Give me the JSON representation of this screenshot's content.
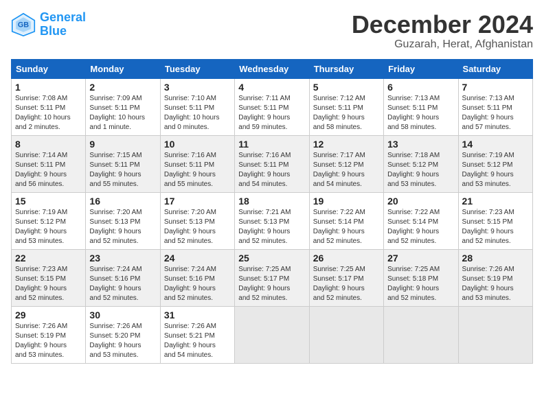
{
  "header": {
    "logo_line1": "General",
    "logo_line2": "Blue",
    "month": "December 2024",
    "location": "Guzarah, Herat, Afghanistan"
  },
  "days_of_week": [
    "Sunday",
    "Monday",
    "Tuesday",
    "Wednesday",
    "Thursday",
    "Friday",
    "Saturday"
  ],
  "weeks": [
    [
      {
        "day": "1",
        "info": "Sunrise: 7:08 AM\nSunset: 5:11 PM\nDaylight: 10 hours\nand 2 minutes."
      },
      {
        "day": "2",
        "info": "Sunrise: 7:09 AM\nSunset: 5:11 PM\nDaylight: 10 hours\nand 1 minute."
      },
      {
        "day": "3",
        "info": "Sunrise: 7:10 AM\nSunset: 5:11 PM\nDaylight: 10 hours\nand 0 minutes."
      },
      {
        "day": "4",
        "info": "Sunrise: 7:11 AM\nSunset: 5:11 PM\nDaylight: 9 hours\nand 59 minutes."
      },
      {
        "day": "5",
        "info": "Sunrise: 7:12 AM\nSunset: 5:11 PM\nDaylight: 9 hours\nand 58 minutes."
      },
      {
        "day": "6",
        "info": "Sunrise: 7:13 AM\nSunset: 5:11 PM\nDaylight: 9 hours\nand 58 minutes."
      },
      {
        "day": "7",
        "info": "Sunrise: 7:13 AM\nSunset: 5:11 PM\nDaylight: 9 hours\nand 57 minutes."
      }
    ],
    [
      {
        "day": "8",
        "info": "Sunrise: 7:14 AM\nSunset: 5:11 PM\nDaylight: 9 hours\nand 56 minutes."
      },
      {
        "day": "9",
        "info": "Sunrise: 7:15 AM\nSunset: 5:11 PM\nDaylight: 9 hours\nand 55 minutes."
      },
      {
        "day": "10",
        "info": "Sunrise: 7:16 AM\nSunset: 5:11 PM\nDaylight: 9 hours\nand 55 minutes."
      },
      {
        "day": "11",
        "info": "Sunrise: 7:16 AM\nSunset: 5:11 PM\nDaylight: 9 hours\nand 54 minutes."
      },
      {
        "day": "12",
        "info": "Sunrise: 7:17 AM\nSunset: 5:12 PM\nDaylight: 9 hours\nand 54 minutes."
      },
      {
        "day": "13",
        "info": "Sunrise: 7:18 AM\nSunset: 5:12 PM\nDaylight: 9 hours\nand 53 minutes."
      },
      {
        "day": "14",
        "info": "Sunrise: 7:19 AM\nSunset: 5:12 PM\nDaylight: 9 hours\nand 53 minutes."
      }
    ],
    [
      {
        "day": "15",
        "info": "Sunrise: 7:19 AM\nSunset: 5:12 PM\nDaylight: 9 hours\nand 53 minutes."
      },
      {
        "day": "16",
        "info": "Sunrise: 7:20 AM\nSunset: 5:13 PM\nDaylight: 9 hours\nand 52 minutes."
      },
      {
        "day": "17",
        "info": "Sunrise: 7:20 AM\nSunset: 5:13 PM\nDaylight: 9 hours\nand 52 minutes."
      },
      {
        "day": "18",
        "info": "Sunrise: 7:21 AM\nSunset: 5:13 PM\nDaylight: 9 hours\nand 52 minutes."
      },
      {
        "day": "19",
        "info": "Sunrise: 7:22 AM\nSunset: 5:14 PM\nDaylight: 9 hours\nand 52 minutes."
      },
      {
        "day": "20",
        "info": "Sunrise: 7:22 AM\nSunset: 5:14 PM\nDaylight: 9 hours\nand 52 minutes."
      },
      {
        "day": "21",
        "info": "Sunrise: 7:23 AM\nSunset: 5:15 PM\nDaylight: 9 hours\nand 52 minutes."
      }
    ],
    [
      {
        "day": "22",
        "info": "Sunrise: 7:23 AM\nSunset: 5:15 PM\nDaylight: 9 hours\nand 52 minutes."
      },
      {
        "day": "23",
        "info": "Sunrise: 7:24 AM\nSunset: 5:16 PM\nDaylight: 9 hours\nand 52 minutes."
      },
      {
        "day": "24",
        "info": "Sunrise: 7:24 AM\nSunset: 5:16 PM\nDaylight: 9 hours\nand 52 minutes."
      },
      {
        "day": "25",
        "info": "Sunrise: 7:25 AM\nSunset: 5:17 PM\nDaylight: 9 hours\nand 52 minutes."
      },
      {
        "day": "26",
        "info": "Sunrise: 7:25 AM\nSunset: 5:17 PM\nDaylight: 9 hours\nand 52 minutes."
      },
      {
        "day": "27",
        "info": "Sunrise: 7:25 AM\nSunset: 5:18 PM\nDaylight: 9 hours\nand 52 minutes."
      },
      {
        "day": "28",
        "info": "Sunrise: 7:26 AM\nSunset: 5:19 PM\nDaylight: 9 hours\nand 53 minutes."
      }
    ],
    [
      {
        "day": "29",
        "info": "Sunrise: 7:26 AM\nSunset: 5:19 PM\nDaylight: 9 hours\nand 53 minutes."
      },
      {
        "day": "30",
        "info": "Sunrise: 7:26 AM\nSunset: 5:20 PM\nDaylight: 9 hours\nand 53 minutes."
      },
      {
        "day": "31",
        "info": "Sunrise: 7:26 AM\nSunset: 5:21 PM\nDaylight: 9 hours\nand 54 minutes."
      },
      {
        "day": "",
        "info": ""
      },
      {
        "day": "",
        "info": ""
      },
      {
        "day": "",
        "info": ""
      },
      {
        "day": "",
        "info": ""
      }
    ]
  ]
}
